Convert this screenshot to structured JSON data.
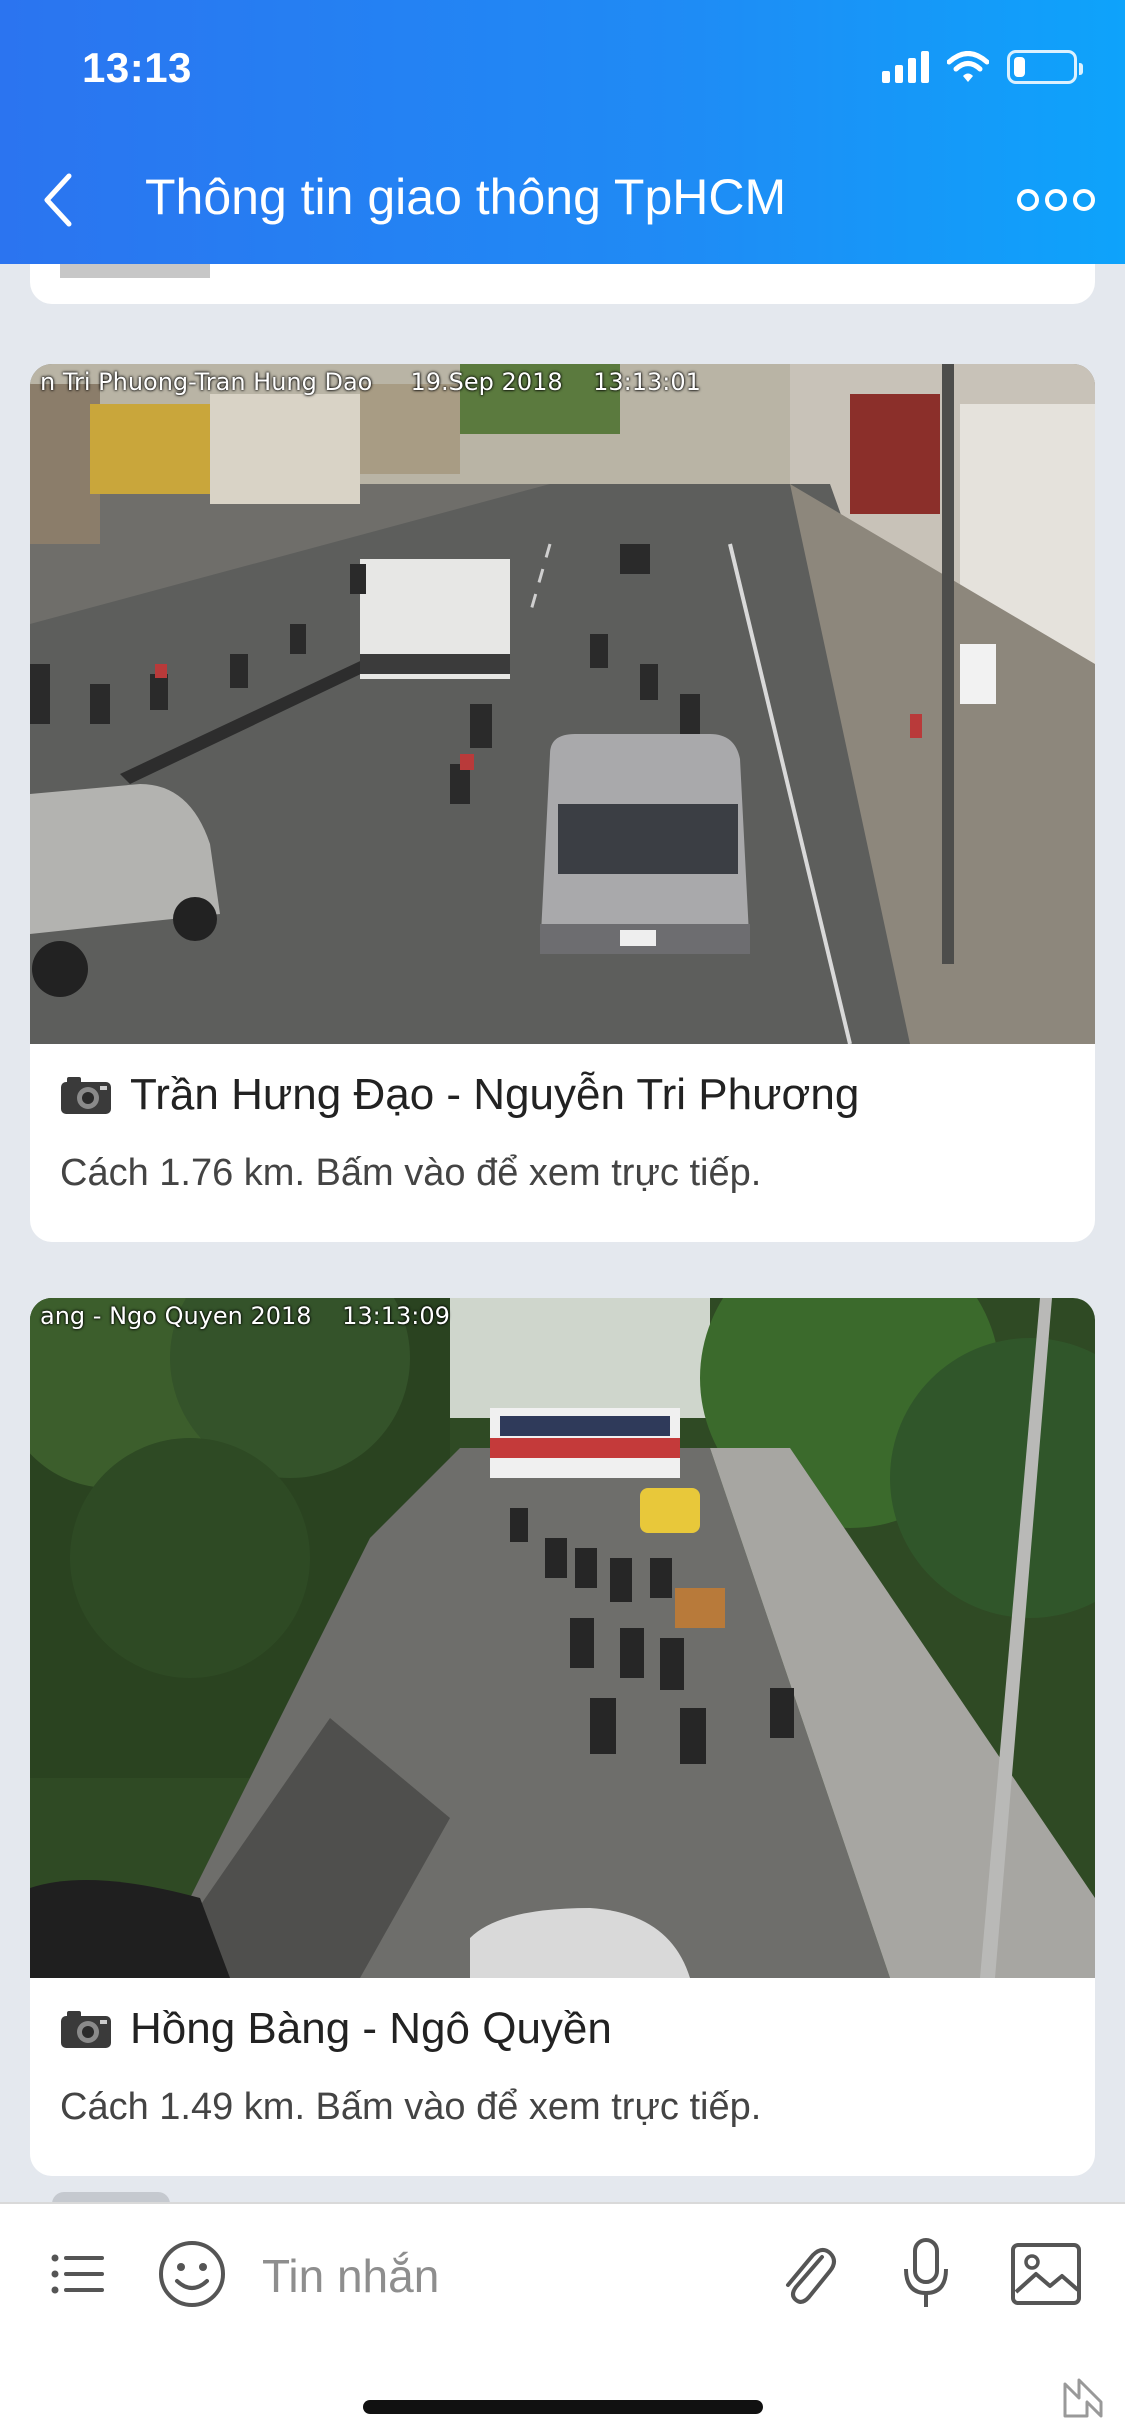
{
  "status_bar": {
    "time": "13:13",
    "battery_level": 0.2
  },
  "nav": {
    "back_icon": "chevron-left-icon",
    "title": "Thông tin giao thông TpHCM",
    "more_icon": "more-dots-icon"
  },
  "cameras": [
    {
      "overlay": "n Tri Phuong-Tran Hung Dao     19.Sep 2018    13:13:01",
      "title": "Trần Hưng Đạo - Nguyễn Tri Phương",
      "subtitle": "Cách 1.76 km. Bấm vào để xem trực tiếp.",
      "icon": "camera-icon"
    },
    {
      "overlay": "ang - Ngo Quyen 2018    13:13:09",
      "title": "Hồng Bàng - Ngô Quyền",
      "subtitle": "Cách 1.49 km. Bấm vào để xem trực tiếp.",
      "icon": "camera-icon"
    }
  ],
  "composer": {
    "placeholder": "Tin nhắn",
    "icons": [
      "menu-list-icon",
      "emoji-icon",
      "paperclip-icon",
      "microphone-icon",
      "image-icon"
    ]
  },
  "colors": {
    "header_start": "#2b74f0",
    "header_end": "#0ea3fb",
    "page_bg": "#e4e8ee"
  }
}
